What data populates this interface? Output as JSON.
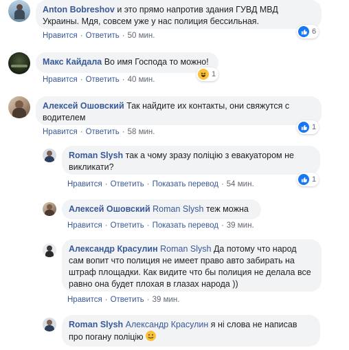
{
  "comments": [
    {
      "author": "Anton Bobreshov",
      "text": "и это прямо напротив здания ГУВД МВД Украины. Мдя, совсем уже у нас полиция бессильная.",
      "like": "Нравится",
      "reply": "Ответить",
      "time": "50 мин.",
      "reaction": {
        "type": "like",
        "count": "6"
      }
    },
    {
      "author": "Макс Кайдала",
      "text": "Во имя Господа то можно!",
      "like": "Нравится",
      "reply": "Ответить",
      "time": "40 мин.",
      "reaction": {
        "type": "haha",
        "count": "1"
      }
    },
    {
      "author": "Алексей Ошовский",
      "text": "Так найдите их контакты, они свяжутся с водителем",
      "like": "Нравится",
      "reply": "Ответить",
      "time": "58 мин.",
      "reaction": {
        "type": "like",
        "count": "1"
      }
    }
  ],
  "replies": [
    {
      "author": "Roman Slysh",
      "text": "так а чому зразу поліцію з евакуатором не викликати?",
      "like": "Нравится",
      "reply": "Ответить",
      "translate": "Показать перевод",
      "time": "54 мин.",
      "reaction": {
        "type": "like",
        "count": "1"
      }
    },
    {
      "author": "Алексей Ошовский",
      "mention": "Roman Slysh",
      "text": "теж можна",
      "like": "Нравится",
      "reply": "Ответить",
      "translate": "Показать перевод",
      "time": "39 мин."
    },
    {
      "author": "Александр Красулин",
      "mention": "Roman Slysh",
      "text": "Да потому что народ сам вопит что полиция не имеет право авто забирать на штраф площадки. Как видите что бы полиция не делала все равно она будет плохая в глазах народа ))",
      "like": "Нравится",
      "reply": "Ответить",
      "time": "39 мин."
    },
    {
      "author": "Roman Slysh",
      "mention": "Александр Красулин",
      "text": "я ні слова не написав про погану поліцію",
      "emoji": "smile"
    }
  ],
  "colors": {
    "link": "#385898",
    "bubble": "#f2f3f5",
    "like": "#1877f2",
    "haha": "#f7c23a"
  }
}
